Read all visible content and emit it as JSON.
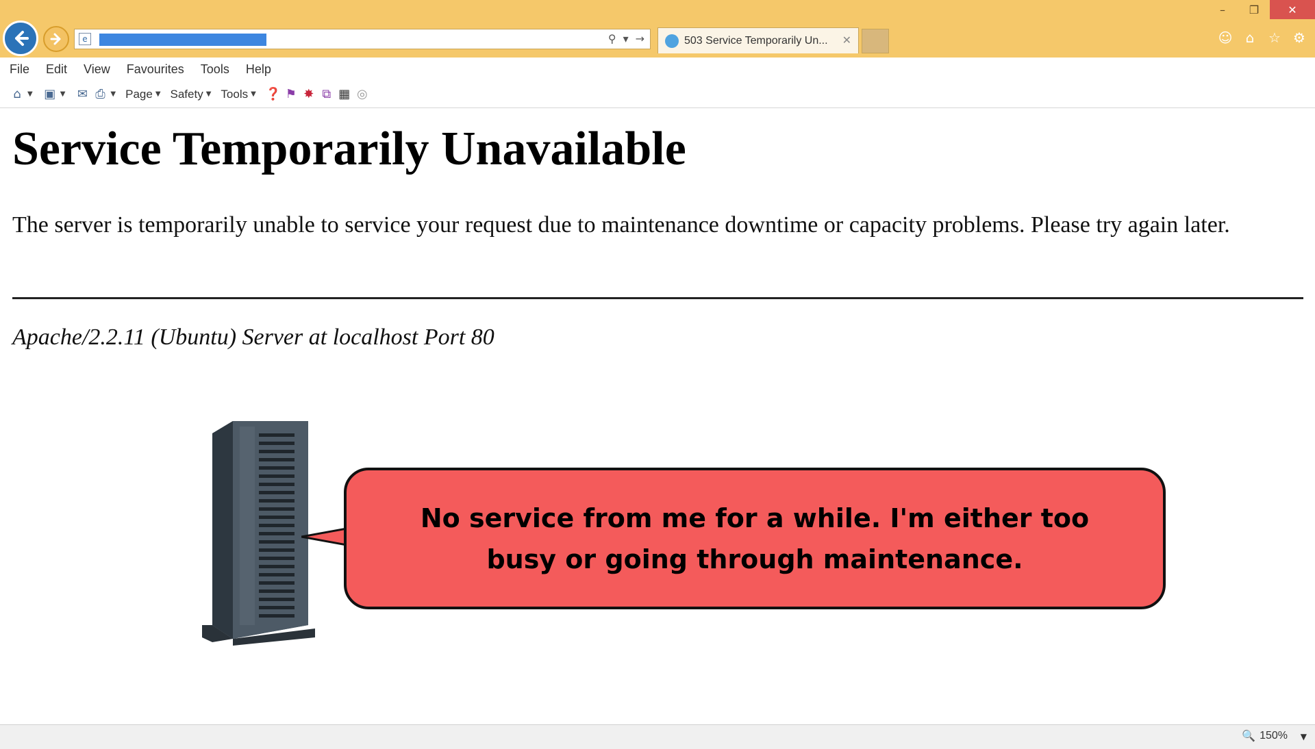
{
  "browser": {
    "tab_title": "503 Service Temporarily Un...",
    "tab_close": "✕",
    "window_controls": {
      "minimize": "–",
      "restore": "❐",
      "close": "✕"
    }
  },
  "menubar": {
    "items": [
      "File",
      "Edit",
      "View",
      "Favourites",
      "Tools",
      "Help"
    ]
  },
  "command_bar": {
    "page_label": "Page",
    "safety_label": "Safety",
    "tools_label": "Tools"
  },
  "page": {
    "heading": "Service Temporarily Unavailable",
    "message": "The server is temporarily unable to service your request due to maintenance downtime or capacity problems. Please try again later.",
    "address": "Apache/2.2.11 (Ubuntu) Server at localhost Port 80",
    "callout": "No service from me for a while. I'm either too busy or going through maintenance."
  },
  "status_bar": {
    "zoom": "150%"
  },
  "colors": {
    "titlebar": "#f5c86a",
    "callout_fill": "#f45b5b",
    "back_button": "#2b73b8"
  }
}
